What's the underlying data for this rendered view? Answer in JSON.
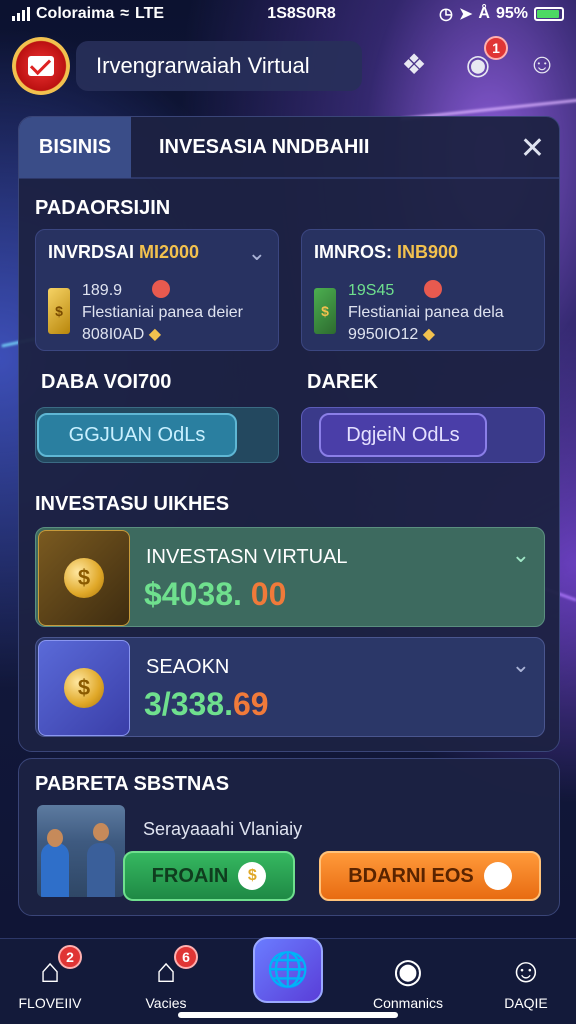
{
  "status_bar": {
    "carrier": "Coloraima",
    "network": "LTE",
    "time": "1S8S0R8",
    "battery": "95%"
  },
  "header": {
    "title": "Irvengrarwaiah Virtual",
    "notif_count": "1"
  },
  "panel": {
    "tab_active": "BISINIS",
    "tab_other": "INVESASIA NNDBAHII",
    "section_label": "PADAORSIJIN",
    "card_left": {
      "title_prefix": "INVRDSAI ",
      "title_accent": "MI2000",
      "line1": "189.9",
      "line2": "Flestianiai panea deier",
      "line3": "808I0AD"
    },
    "card_right": {
      "title_prefix": "IMNROS: ",
      "title_accent": "INB900",
      "line1": "19S45",
      "line2": "Flestianiai panea dela",
      "line3": "9950IO12"
    },
    "label_left": "DABA VOI700",
    "label_right": "DAREK",
    "btn_left": "GGJUAN OdLs",
    "btn_right": "DgjeiN OdLs",
    "invest_section": "INVESTASU UIKHES",
    "invest_rows": [
      {
        "name": "INVESTASN VIRTUAL",
        "amount_a": "$4038.",
        "amount_b": "00"
      },
      {
        "name": "SEAOKN",
        "amount_a": "3/338.",
        "amount_b": "69"
      }
    ]
  },
  "promo": {
    "title": "PABRETA SBSTNAS",
    "subtitle": "Serayaaahi Vlaniaiy",
    "btn_green": "FROAIN",
    "btn_orange": "BDARNI EOS"
  },
  "nav": [
    {
      "label": "FLOVEIIV",
      "badge": "2"
    },
    {
      "label": "Vacies",
      "badge": "6"
    },
    {
      "label": ""
    },
    {
      "label": "Conmanics"
    },
    {
      "label": "DAQIE"
    }
  ],
  "colors": {
    "accent_gold": "#f2c14e",
    "badge_red": "#e03535",
    "amount_green": "#6fe08e",
    "amount_orange": "#f07a3a"
  }
}
